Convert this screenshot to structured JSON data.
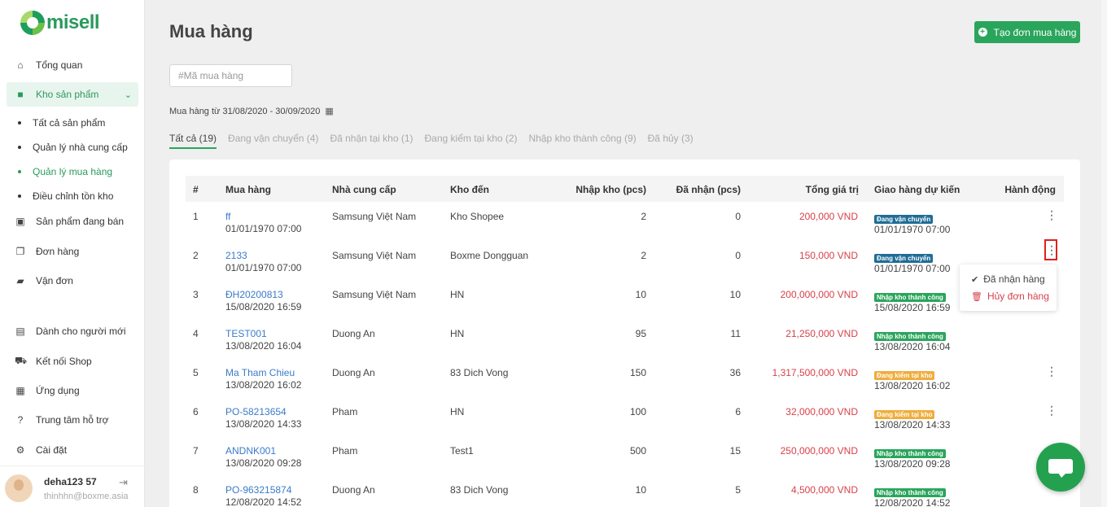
{
  "brand": {
    "logo_text": "misell",
    "accent": "#2aa55c"
  },
  "sidebar": {
    "items": [
      {
        "label": "Tổng quan",
        "icon": "home-icon"
      },
      {
        "label": "Kho sản phẩm",
        "icon": "box-icon"
      },
      {
        "label": "Sản phẩm đang bán",
        "icon": "shopping-bag-icon"
      },
      {
        "label": "Đơn hàng",
        "icon": "copy-icon"
      },
      {
        "label": "Vận đơn",
        "icon": "truck-icon"
      },
      {
        "label": "Dành cho người mới",
        "icon": "book-icon"
      },
      {
        "label": "Kết nối Shop",
        "icon": "cart-icon"
      },
      {
        "label": "Ứng dụng",
        "icon": "apps-icon"
      },
      {
        "label": "Trung tâm hỗ trợ",
        "icon": "question-icon"
      },
      {
        "label": "Cài đặt",
        "icon": "gear-icon"
      }
    ],
    "sub_items": [
      {
        "label": "Tất cả sản phẩm"
      },
      {
        "label": "Quản lý nhà cung cấp"
      },
      {
        "label": "Quản lý mua hàng"
      },
      {
        "label": "Điều chỉnh tồn kho"
      }
    ],
    "user": {
      "name": "deha123 57",
      "email": "thinhhn@boxme.asia"
    }
  },
  "header": {
    "title": "Mua hàng",
    "create_button": "Tạo đơn mua hàng",
    "search_placeholder": "#Mã mua hàng",
    "date_range": "Mua hàng từ 31/08/2020 - 30/09/2020"
  },
  "tabs": [
    {
      "label": "Tất cả (19)"
    },
    {
      "label": "Đang vận chuyển (4)"
    },
    {
      "label": "Đã nhận tại kho (1)"
    },
    {
      "label": "Đang kiểm tại kho (2)"
    },
    {
      "label": "Nhập kho thành công (9)"
    },
    {
      "label": "Đã hủy (3)"
    }
  ],
  "table": {
    "columns": {
      "idx": "#",
      "order": "Mua hàng",
      "supplier": "Nhà cung cấp",
      "warehouse": "Kho đến",
      "imported": "Nhập kho (pcs)",
      "received": "Đã nhận (pcs)",
      "total": "Tổng giá trị",
      "delivery": "Giao hàng dự kiến",
      "action": "Hành động"
    },
    "rows": [
      {
        "idx": "1",
        "code": "ff",
        "date": "01/01/1970 07:00",
        "supplier": "Samsung Việt Nam",
        "warehouse": "Kho Shopee",
        "imported": "2",
        "received": "0",
        "total": "200,000 VND",
        "status": "Đang vận chuyển",
        "status_color": "#1f6d96",
        "eta": "01/01/1970 07:00"
      },
      {
        "idx": "2",
        "code": "2133",
        "date": "01/01/1970 07:00",
        "supplier": "Samsung Việt Nam",
        "warehouse": "Boxme Dongguan",
        "imported": "2",
        "received": "0",
        "total": "150,000 VND",
        "status": "Đang vận chuyển",
        "status_color": "#1f6d96",
        "eta": "01/01/1970 07:00"
      },
      {
        "idx": "3",
        "code": "ĐH20200813",
        "date": "15/08/2020 16:59",
        "supplier": "Samsung Việt Nam",
        "warehouse": "HN",
        "imported": "10",
        "received": "10",
        "total": "200,000,000 VND",
        "status": "Nhập kho thành công",
        "status_color": "#2aa55c",
        "eta": "15/08/2020 16:59"
      },
      {
        "idx": "4",
        "code": "TEST001",
        "date": "13/08/2020 16:04",
        "supplier": "Duong An",
        "warehouse": "HN",
        "imported": "95",
        "received": "11",
        "total": "21,250,000 VND",
        "status": "Nhập kho thành công",
        "status_color": "#2aa55c",
        "eta": "13/08/2020 16:04"
      },
      {
        "idx": "5",
        "code": "Ma Tham Chieu",
        "date": "13/08/2020 16:02",
        "supplier": "Duong An",
        "warehouse": "83 Dich Vong",
        "imported": "150",
        "received": "36",
        "total": "1,317,500,000 VND",
        "status": "Đang kiểm tại kho",
        "status_color": "#f0ad3c",
        "eta": "13/08/2020 16:02"
      },
      {
        "idx": "6",
        "code": "PO-58213654",
        "date": "13/08/2020 14:33",
        "supplier": "Pham",
        "warehouse": "HN",
        "imported": "100",
        "received": "6",
        "total": "32,000,000 VND",
        "status": "Đang kiểm tại kho",
        "status_color": "#f0ad3c",
        "eta": "13/08/2020 14:33"
      },
      {
        "idx": "7",
        "code": "ANDNK001",
        "date": "13/08/2020 09:28",
        "supplier": "Pham",
        "warehouse": "Test1",
        "imported": "500",
        "received": "15",
        "total": "250,000,000 VND",
        "status": "Nhập kho thành công",
        "status_color": "#2aa55c",
        "eta": "13/08/2020 09:28"
      },
      {
        "idx": "8",
        "code": "PO-963215874",
        "date": "12/08/2020 14:52",
        "supplier": "Duong An",
        "warehouse": "83 Dich Vong",
        "imported": "10",
        "received": "5",
        "total": "4,500,000 VND",
        "status": "Nhập kho thành công",
        "status_color": "#2aa55c",
        "eta": "12/08/2020 14:52"
      }
    ]
  },
  "dropdown": {
    "received": "Đã nhận hàng",
    "cancel": "Hủy đơn hàng"
  }
}
